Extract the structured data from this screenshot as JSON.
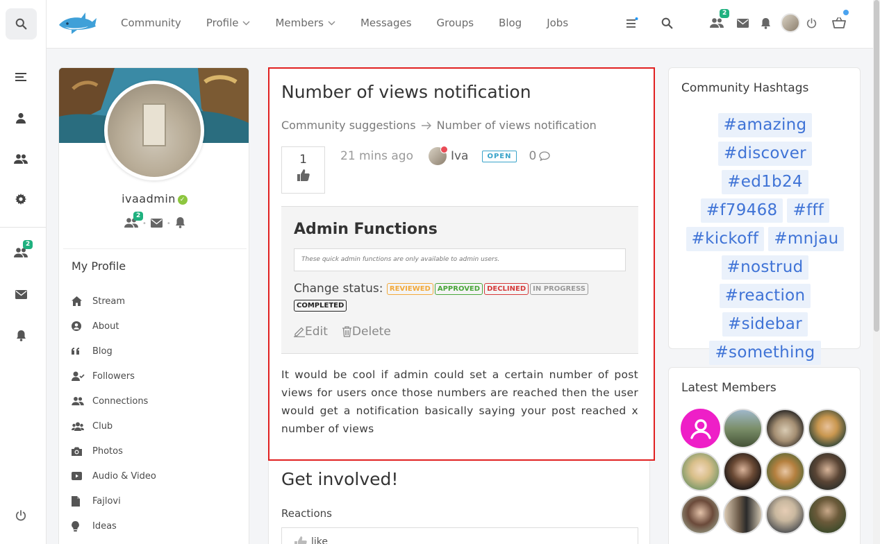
{
  "nav": {
    "items": [
      {
        "label": "Community",
        "has_chevron": false
      },
      {
        "label": "Profile",
        "has_chevron": true
      },
      {
        "label": "Members",
        "has_chevron": true
      },
      {
        "label": "Messages",
        "has_chevron": false
      },
      {
        "label": "Groups",
        "has_chevron": false
      },
      {
        "label": "Blog",
        "has_chevron": false
      },
      {
        "label": "Jobs",
        "has_chevron": false
      }
    ],
    "friends_badge": "2"
  },
  "rail": {
    "friends_badge": "2"
  },
  "profile": {
    "username": "ivaadmin",
    "friends_badge": "2",
    "section_title": "My Profile",
    "menu": [
      {
        "label": "Stream",
        "icon": "home-icon"
      },
      {
        "label": "About",
        "icon": "user-circle-icon"
      },
      {
        "label": "Blog",
        "icon": "quote-icon"
      },
      {
        "label": "Followers",
        "icon": "user-check-icon"
      },
      {
        "label": "Connections",
        "icon": "users-icon"
      },
      {
        "label": "Club",
        "icon": "group-icon"
      },
      {
        "label": "Photos",
        "icon": "camera-icon"
      },
      {
        "label": "Audio & Video",
        "icon": "video-icon"
      },
      {
        "label": "Fajlovi",
        "icon": "file-icon"
      },
      {
        "label": "Ideas",
        "icon": "bulb-icon"
      }
    ]
  },
  "article": {
    "title": "Number of views notification",
    "breadcrumb_parent": "Community suggestions",
    "breadcrumb_current": "Number of views notification",
    "votes": "1",
    "time_ago": "21 mins ago",
    "author": "Iva",
    "status": "OPEN",
    "comment_count": "0",
    "admin_title": "Admin Functions",
    "admin_note": "These quick admin functions are only available to admin users.",
    "change_status_label": "Change status:",
    "statuses": {
      "reviewed": "REVIEWED",
      "approved": "APPROVED",
      "declined": "DECLINED",
      "in_progress": "IN PROGRESS",
      "completed": "COMPLETED"
    },
    "edit_label": "Edit",
    "delete_label": "Delete",
    "body": "It would be cool if admin could set a certain number of post views for users once those numbers are reached then the user would get a notification basically saying your post reached x number of views"
  },
  "involved": {
    "title": "Get involved!",
    "reactions_label": "Reactions",
    "like_label": "like"
  },
  "hashtags": {
    "title": "Community Hashtags",
    "tags": [
      "#amazing",
      "#discover",
      "#ed1b24",
      "#f79468",
      "#fff",
      "#kickoff",
      "#mnjau",
      "#nostrud",
      "#reaction",
      "#sidebar",
      "#something"
    ]
  },
  "members": {
    "title": "Latest Members"
  },
  "colors": {
    "accent": "#3f73d6",
    "highlight_border": "#e02020",
    "badge": "#1fb17f",
    "tag_bg": "#eaf1fb"
  }
}
